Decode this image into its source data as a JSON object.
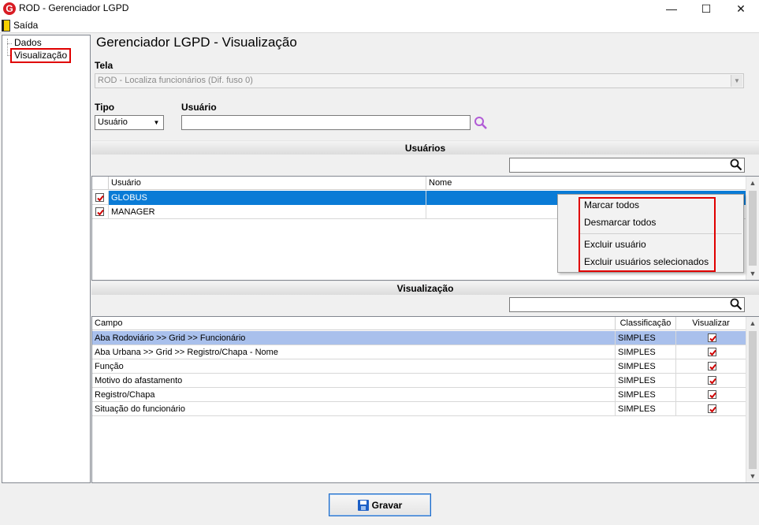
{
  "window": {
    "title": "ROD - Gerenciador LGPD",
    "logo_letter": "G",
    "min": "—",
    "max": "☐",
    "close": "✕"
  },
  "menu": {
    "exit_label": "Saída"
  },
  "tree": {
    "items": [
      {
        "label": "Dados"
      },
      {
        "label": "Visualização"
      }
    ]
  },
  "page": {
    "title": "Gerenciador LGPD - Visualização"
  },
  "tela": {
    "label": "Tela",
    "value": "ROD - Localiza funcionários (Dif. fuso 0)"
  },
  "tipo": {
    "label": "Tipo",
    "value": "Usuário"
  },
  "usuario": {
    "label": "Usuário",
    "value": ""
  },
  "usuarios_section": {
    "title": "Usuários",
    "filter_value": "",
    "columns": [
      "Usuário",
      "Nome"
    ],
    "rows": [
      {
        "usuario": "GLOBUS",
        "nome": "",
        "checked": true
      },
      {
        "usuario": "MANAGER",
        "nome": "",
        "checked": true
      }
    ]
  },
  "context_menu": {
    "items": [
      "Marcar todos",
      "Desmarcar todos",
      "Excluir usuário",
      "Excluir usuários selecionados"
    ]
  },
  "visualizacao_section": {
    "title": "Visualização",
    "filter_value": "",
    "columns": [
      "Campo",
      "Classificação",
      "Visualizar"
    ],
    "rows": [
      {
        "campo": "Aba Rodoviário >> Grid >> Funcionário",
        "classificacao": "SIMPLES",
        "visualizar": true
      },
      {
        "campo": "Aba Urbana >> Grid >> Registro/Chapa  - Nome",
        "classificacao": "SIMPLES",
        "visualizar": true
      },
      {
        "campo": "Função",
        "classificacao": "SIMPLES",
        "visualizar": true
      },
      {
        "campo": "Motivo do afastamento",
        "classificacao": "SIMPLES",
        "visualizar": true
      },
      {
        "campo": "Registro/Chapa",
        "classificacao": "SIMPLES",
        "visualizar": true
      },
      {
        "campo": "Situação do funcionário",
        "classificacao": "SIMPLES",
        "visualizar": true
      }
    ]
  },
  "footer": {
    "save_label": "Gravar"
  },
  "colors": {
    "selected_row": "#0a7bd6",
    "selected_row_light": "#a9c0ec",
    "highlight_box": "#e00000",
    "check": "#d00000"
  }
}
